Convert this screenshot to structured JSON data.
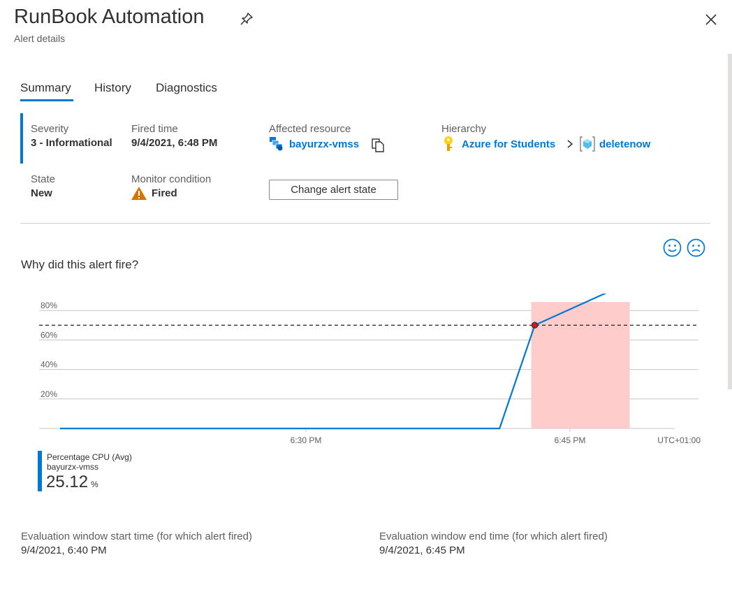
{
  "header": {
    "title": "RunBook Automation",
    "subtitle": "Alert details"
  },
  "tabs": [
    {
      "label": "Summary",
      "active": true
    },
    {
      "label": "History",
      "active": false
    },
    {
      "label": "Diagnostics",
      "active": false
    }
  ],
  "summary": {
    "severity_label": "Severity",
    "severity_value": "3 - Informational",
    "fired_label": "Fired time",
    "fired_value": "9/4/2021, 6:48 PM",
    "resource_label": "Affected resource",
    "resource_value": "bayurzx-vmss",
    "hierarchy_label": "Hierarchy",
    "hierarchy_items": [
      "Azure for Students",
      "deletenow"
    ],
    "state_label": "State",
    "state_value": "New",
    "monitor_label": "Monitor condition",
    "monitor_value": "Fired",
    "change_button": "Change alert state"
  },
  "feedback": {
    "positive_icon": "smile-icon",
    "negative_icon": "frown-icon"
  },
  "why_title": "Why did this alert fire?",
  "colors": {
    "accent": "#0078d4",
    "alert_window": "#ffcccc",
    "threshold_line": "#323130",
    "fired_point": "#e81123",
    "warning": "#d47500"
  },
  "chart_data": {
    "type": "line",
    "x_tick_labels": [
      "6:30 PM",
      "6:45 PM"
    ],
    "timezone_label": "UTC+01:00",
    "y_tick_labels": [
      "80%",
      "60%",
      "40%",
      "20%"
    ],
    "ylim": [
      0,
      100
    ],
    "grid": true,
    "threshold": 70,
    "alert_window": {
      "start": "6:43 PM",
      "end": "6:48 PM"
    },
    "series": [
      {
        "name": "Percentage CPU (Avg)",
        "resource": "bayurzx-vmss",
        "x": [
          "6:18 PM",
          "6:41 PM",
          "6:43 PM",
          "6:48 PM"
        ],
        "values": [
          0,
          0,
          70,
          97
        ]
      }
    ]
  },
  "legend": {
    "metric": "Percentage CPU (Avg)",
    "resource": "bayurzx-vmss",
    "value": "25.12",
    "unit": "%"
  },
  "evaluation": {
    "start_label": "Evaluation window start time (for which alert fired)",
    "start_value": "9/4/2021, 6:40 PM",
    "end_label": "Evaluation window end time (for which alert fired)",
    "end_value": "9/4/2021, 6:45 PM"
  }
}
